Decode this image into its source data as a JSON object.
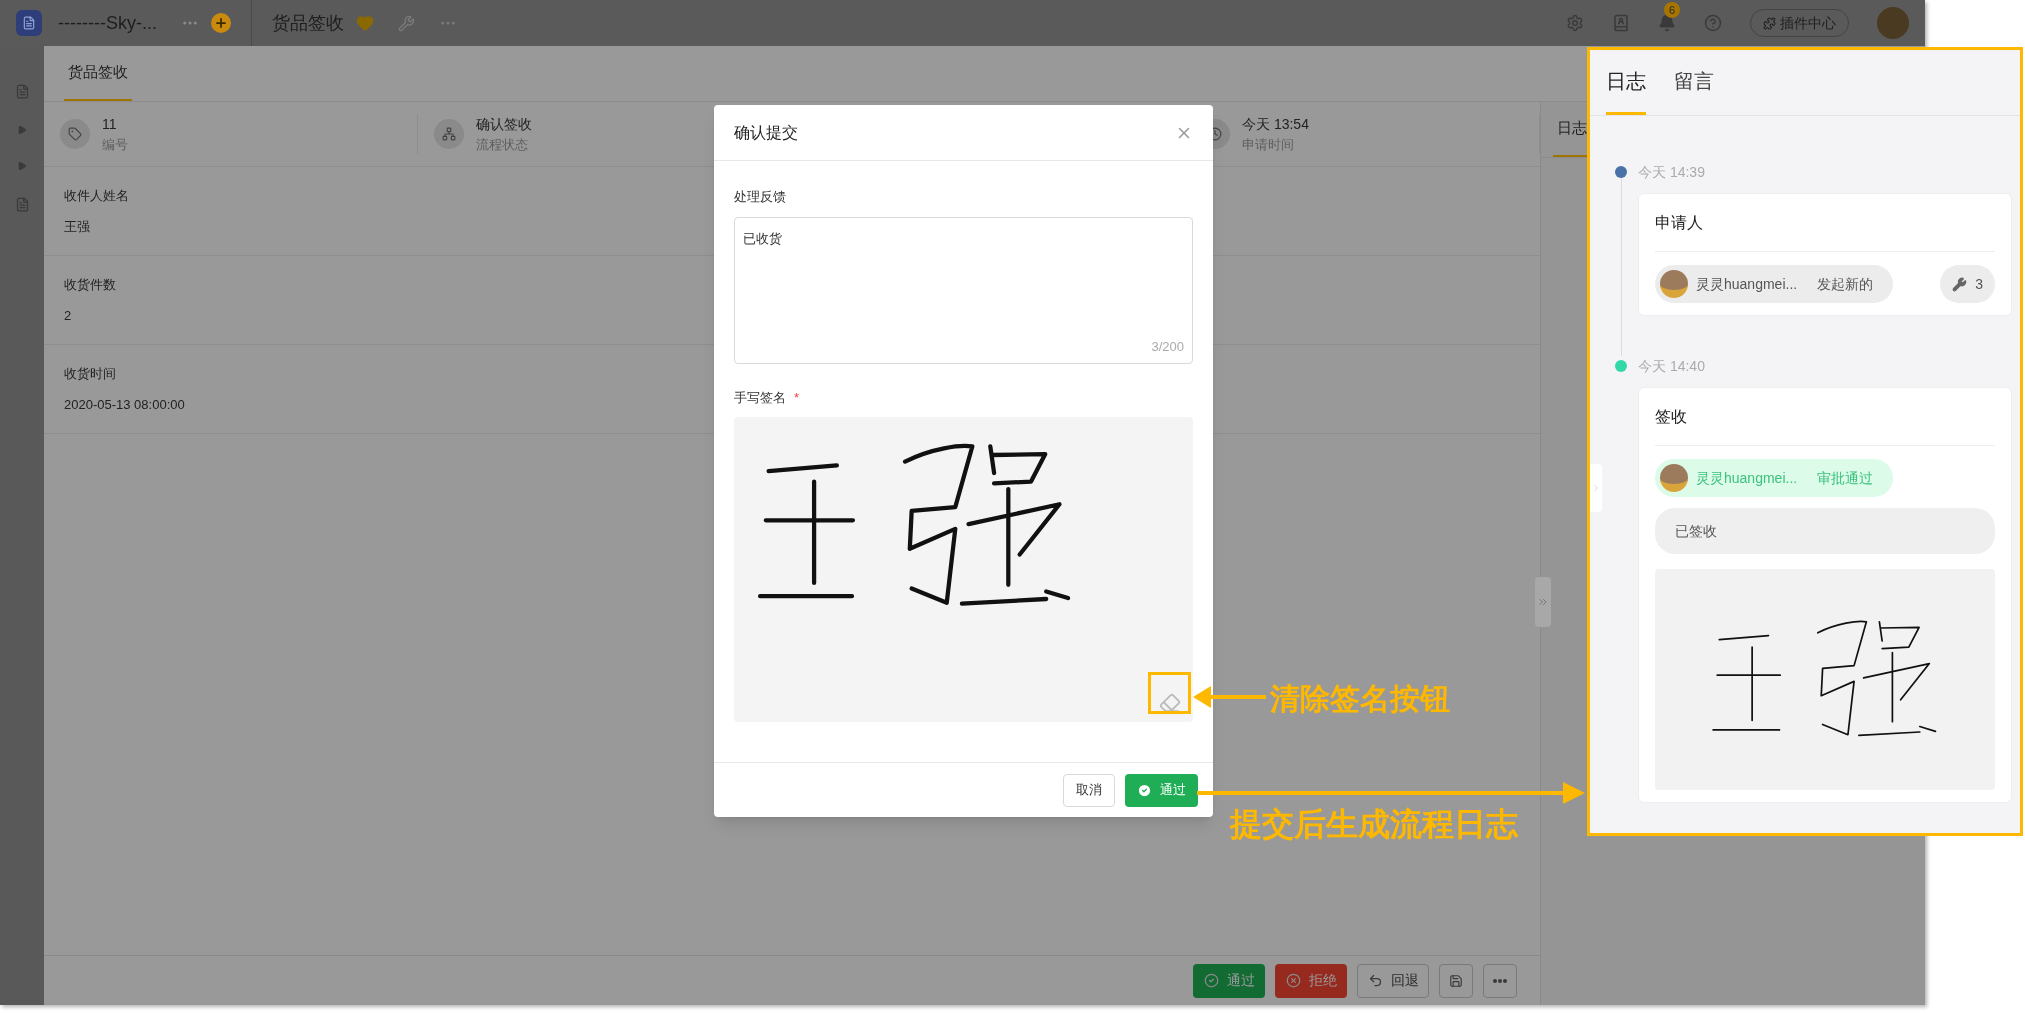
{
  "app_bar": {
    "workspace": "--------Sky-...",
    "page_title": "货品签收",
    "notification_count": "6",
    "plugin_button": "插件中心"
  },
  "page": {
    "tabs": [
      {
        "label": "货品签收",
        "selected": true
      }
    ],
    "summary": [
      {
        "value": "11",
        "label": "编号",
        "kind": "id"
      },
      {
        "value": "确认签收",
        "label": "流程状态",
        "kind": "flow"
      },
      {
        "value": "今天 13:54",
        "label": "申请时间",
        "kind": "time"
      }
    ],
    "fields": [
      {
        "label": "收件人姓名",
        "value": "王强"
      },
      {
        "label": "收货件数",
        "value": "2"
      },
      {
        "label": "收货时间",
        "value": "2020-05-13 08:00:00"
      }
    ],
    "side_tabs": [
      {
        "label": "日志",
        "selected": true
      }
    ],
    "actions": [
      {
        "kind": "approve",
        "label": "通过"
      },
      {
        "kind": "reject",
        "label": "拒绝"
      },
      {
        "kind": "return",
        "label": "回退"
      },
      {
        "kind": "save"
      },
      {
        "kind": "more"
      }
    ]
  },
  "dialog": {
    "title": "确认提交",
    "feedback_label": "处理反馈",
    "feedback_value": "已收货",
    "counter": "3/200",
    "signature_label": "手写签名",
    "required_mark": "*",
    "buttons": [
      {
        "kind": "cancel",
        "label": "取消"
      },
      {
        "kind": "approve",
        "label": "通过"
      }
    ]
  },
  "log_panel": {
    "tabs": [
      {
        "label": "日志",
        "selected": true
      },
      {
        "label": "留言",
        "selected": false
      }
    ],
    "entries": [
      {
        "time": "今天 14:39",
        "color": "#4a72a8",
        "title": "申请人",
        "user": "灵灵huangmei...",
        "action": "发起新的",
        "kind": "neutral",
        "count": "3"
      },
      {
        "time": "今天 14:40",
        "color": "#34d8a8",
        "title": "签收",
        "user": "灵灵huangmei...",
        "action": "审批通过",
        "kind": "approved",
        "comment": "已签收"
      }
    ]
  },
  "annotations": [
    {
      "kind": "clear",
      "text": "清除签名按钮"
    },
    {
      "kind": "log",
      "text": "提交后生成流程日志"
    }
  ]
}
